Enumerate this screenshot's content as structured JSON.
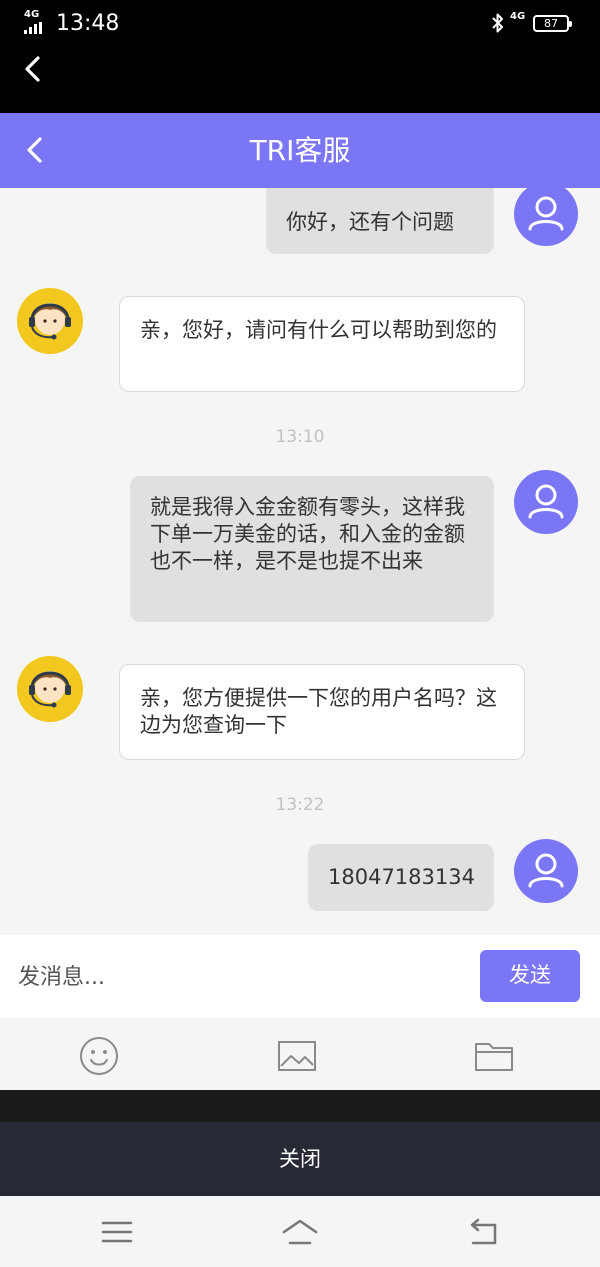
{
  "status_bar": {
    "network_left": "4G",
    "time": "13:48",
    "network_right": "4G",
    "battery": "87"
  },
  "header": {
    "title": "TRI客服"
  },
  "messages": [
    {
      "role": "user",
      "text": "你好，还有个问题"
    },
    {
      "role": "agent",
      "text": "亲，您好，请问有什么可以帮助到您的"
    },
    {
      "role": "timestamp",
      "text": "13:10"
    },
    {
      "role": "user",
      "text": "就是我得入金金额有零头，这样我下单一万美金的话，和入金的金额也不一样，是不是也提不出来"
    },
    {
      "role": "agent",
      "text": "亲，您方便提供一下您的用户名吗？这边为您查询一下"
    },
    {
      "role": "timestamp",
      "text": "13:22"
    },
    {
      "role": "user",
      "text": "18047183134"
    }
  ],
  "input": {
    "placeholder": "发消息...",
    "value": "",
    "send_label": "发送"
  },
  "toolbar": {
    "icons": [
      "emoji-icon",
      "image-icon",
      "folder-icon"
    ]
  },
  "close_label": "关闭",
  "nav": {
    "icons": [
      "menu-icon",
      "home-icon",
      "back-icon"
    ]
  },
  "colors": {
    "accent": "#7b76f6",
    "agent_avatar": "#f2c81e",
    "user_bubble": "#e0e0e0",
    "close_bar": "#272a34"
  }
}
